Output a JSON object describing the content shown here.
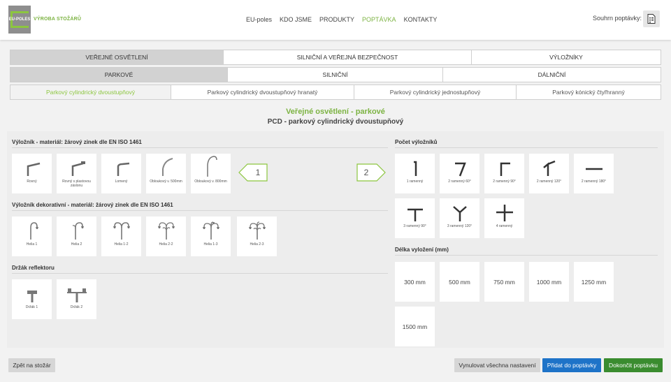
{
  "header": {
    "logo_text": "EU-POLES",
    "brand": "VÝROBA STOŽÁRŮ",
    "nav": [
      {
        "label": "EU-poles",
        "active": false
      },
      {
        "label": "KDO JSME",
        "active": false
      },
      {
        "label": "PRODUKTY",
        "active": false
      },
      {
        "label": "POPTÁVKA",
        "active": true
      },
      {
        "label": "KONTAKTY",
        "active": false
      }
    ],
    "summary_label": "Souhrn poptávky:",
    "summary_icon": "document-list-icon"
  },
  "tabs_level1": [
    {
      "label": "VEŘEJNÉ OSVĚTLENÍ",
      "active": true
    },
    {
      "label": "SILNIČNÍ A VEŘEJNÁ BEZPEČNOST",
      "active": false
    },
    {
      "label": "VÝLOŽNÍKY",
      "active": false
    }
  ],
  "tabs_level2": [
    {
      "label": "PARKOVÉ",
      "active": true
    },
    {
      "label": "SILNIČNÍ",
      "active": false
    },
    {
      "label": "DÁLNIČNÍ",
      "active": false
    }
  ],
  "tabs_level3": [
    {
      "label": "Parkový cylindrický dvoustupňový",
      "active": true
    },
    {
      "label": "Parkový cylindrický dvoustupňový hranatý",
      "active": false
    },
    {
      "label": "Parkový cylindrický jednostupňový",
      "active": false
    },
    {
      "label": "Parkový kónický čtyřhranný",
      "active": false
    }
  ],
  "title": "Veřejné osvětlení - parkové",
  "subtitle": "PCD - parkový cylindrický dvoustupňový",
  "sections": {
    "arm": {
      "title": "Výložník - materiál: žárový zinek dle EN ISO 1461",
      "items": [
        "Rovný",
        "Rovný s plastovou záslonu",
        "Lomený",
        "Obloukový v. 500mm",
        "Obloukový v. 800mm"
      ]
    },
    "decor": {
      "title": "Výložník dekorativní - materiál: žárový zinek dle EN ISO 1461",
      "items": [
        "Helia 1",
        "Helia 2",
        "Helia 1-2",
        "Helia 2-2",
        "Helia 1-3",
        "Helia 2-3"
      ]
    },
    "holder": {
      "title": "Držák reflektoru",
      "items": [
        "Držák 1",
        "Držák 2"
      ]
    },
    "count": {
      "title": "Počet výložníků",
      "items": [
        "1 ramenný",
        "2 ramenný 60°",
        "2 ramenný 90°",
        "2 ramenný 120°",
        "2 ramenný 180°",
        "3 ramenný 90°",
        "3 ramenný 120°",
        "4 ramenný"
      ]
    },
    "length": {
      "title": "Délka vyložení (mm)",
      "items": [
        "300 mm",
        "500 mm",
        "750 mm",
        "1000 mm",
        "1250 mm",
        "1500 mm"
      ]
    }
  },
  "steps": {
    "left": "1",
    "right": "2"
  },
  "footer": {
    "back": "Zpět na stožár",
    "reset": "Vynulovat všechna nastavení",
    "add": "Přidat do poptávky",
    "done": "Dokončit poptávku"
  },
  "colors": {
    "accent": "#7cb342",
    "primary": "#1e73c8",
    "success": "#3a8c2f"
  }
}
